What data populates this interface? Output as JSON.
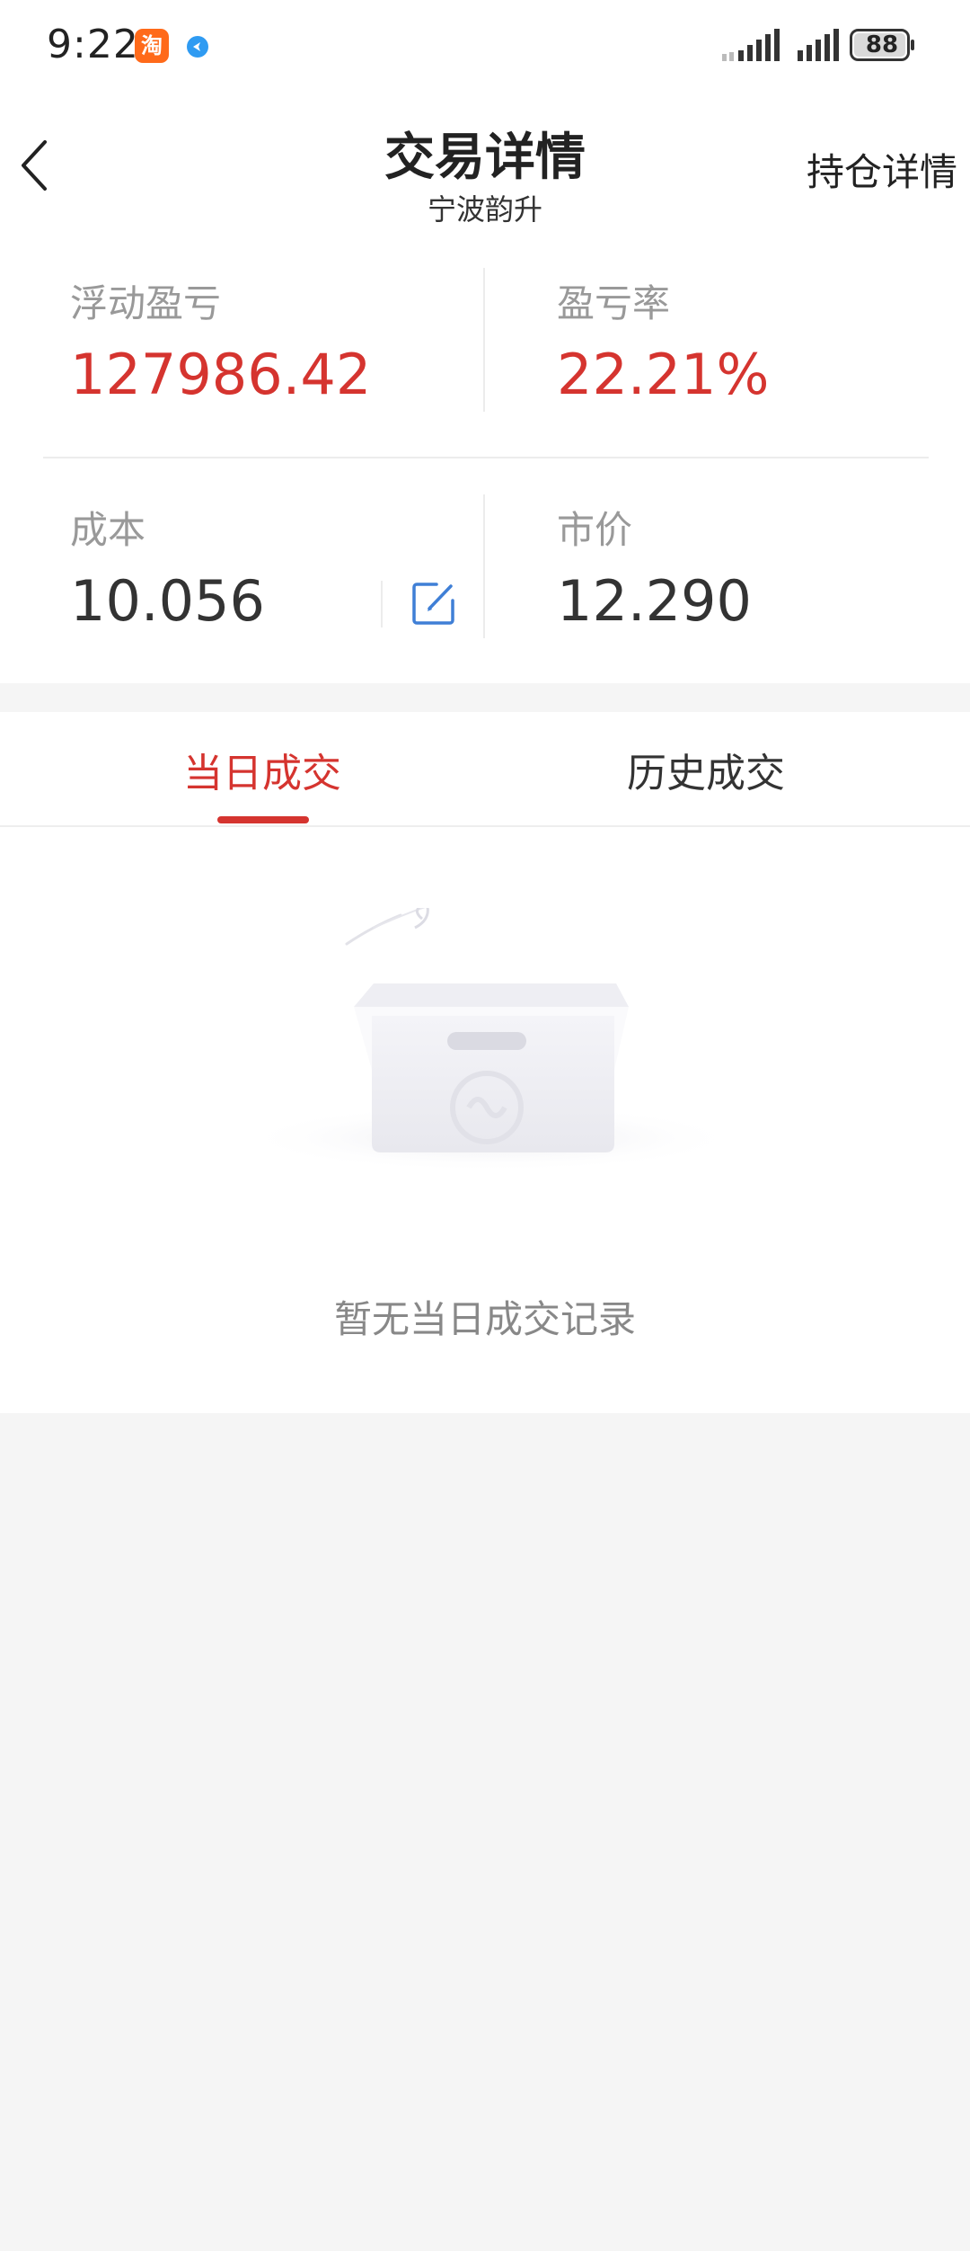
{
  "status_bar": {
    "time": "9:22",
    "app_icon_text": "淘",
    "battery": "88"
  },
  "nav": {
    "title": "交易详情",
    "subtitle": "宁波韵升",
    "right_link": "持仓详情"
  },
  "summary": {
    "floating_pnl_label": "浮动盈亏",
    "floating_pnl_value": "127986.42",
    "pnl_rate_label": "盈亏率",
    "pnl_rate_value": "22.21%",
    "cost_label": "成本",
    "cost_value": "10.056",
    "market_price_label": "市价",
    "market_price_value": "12.290"
  },
  "tabs": [
    {
      "label": "当日成交",
      "active": true
    },
    {
      "label": "历史成交",
      "active": false
    }
  ],
  "empty_state": {
    "message": "暂无当日成交记录"
  },
  "colors": {
    "accent_red": "#d5342f",
    "edit_blue": "#3f7fd6"
  }
}
